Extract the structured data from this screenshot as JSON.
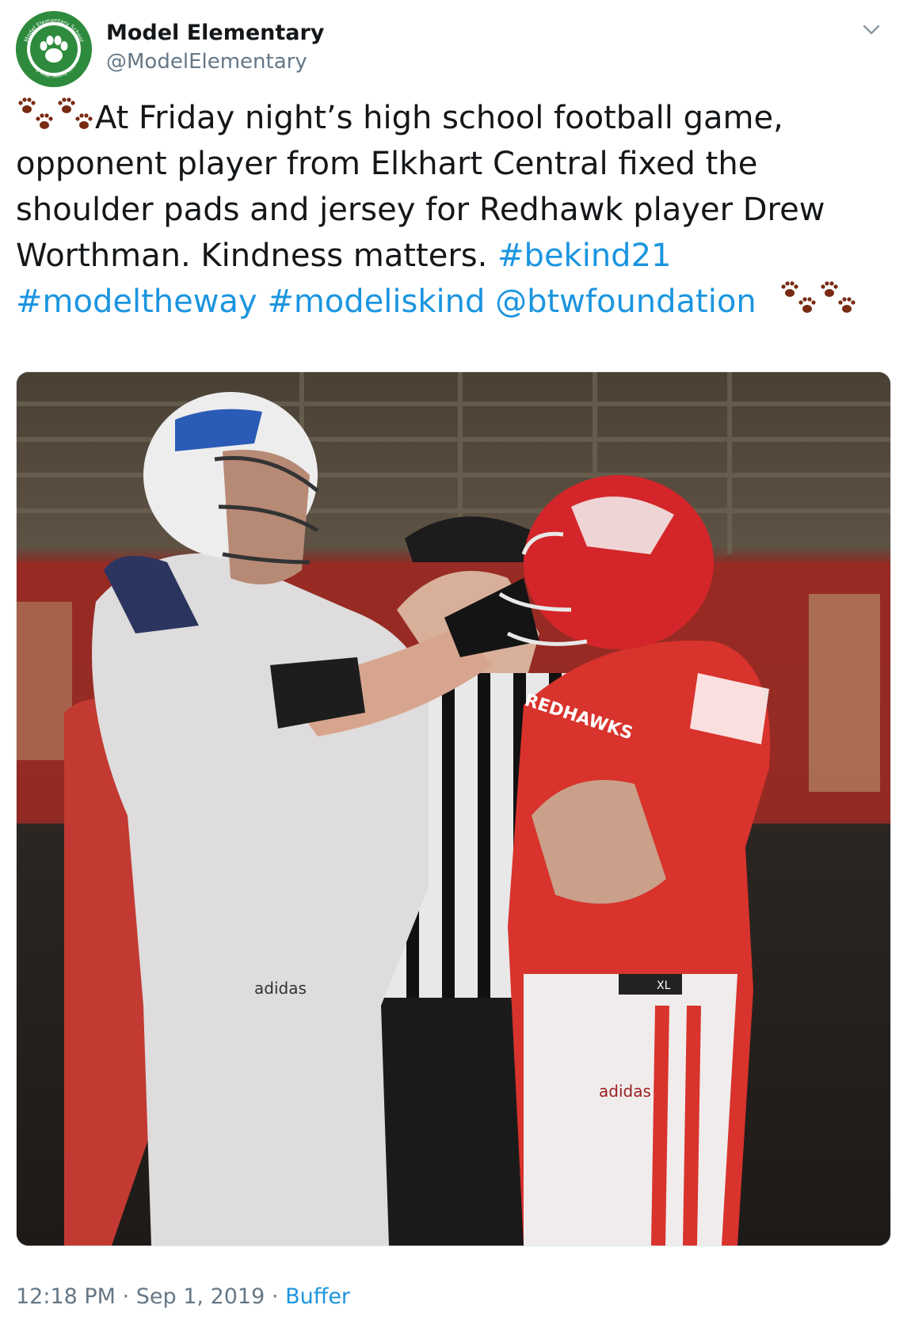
{
  "author": {
    "display_name": "Model Elementary",
    "handle": "@ModelElementary",
    "avatar_text_top": "Model Elementary School",
    "avatar_text_bottom": "Learning Today, Leading Tomorrow"
  },
  "tweet": {
    "text_main": "At Friday night’s high school football game, opponent player from Elkhart Central fixed the shoulder pads and jersey for Redhawk player Drew Worthman. Kindness matters.",
    "hashtags": [
      "#bekind21",
      "#modeltheway",
      "#modeliskind"
    ],
    "mention": "@btwfoundation",
    "emoji_icon": "paw-prints-icon",
    "photo_text": {
      "jersey_lettering": "REDHAWKS",
      "brand_1": "adidas",
      "brand_2": "adidas",
      "size_tag": "XL"
    }
  },
  "meta": {
    "time": "12:18 PM",
    "separator": "·",
    "date": "Sep 1, 2019",
    "source": "Buffer"
  },
  "colors": {
    "link": "#1b95e0",
    "text": "#14171a",
    "secondary": "#657786",
    "paw": "#7a2a12",
    "avatar_green": "#2e8b3d"
  }
}
